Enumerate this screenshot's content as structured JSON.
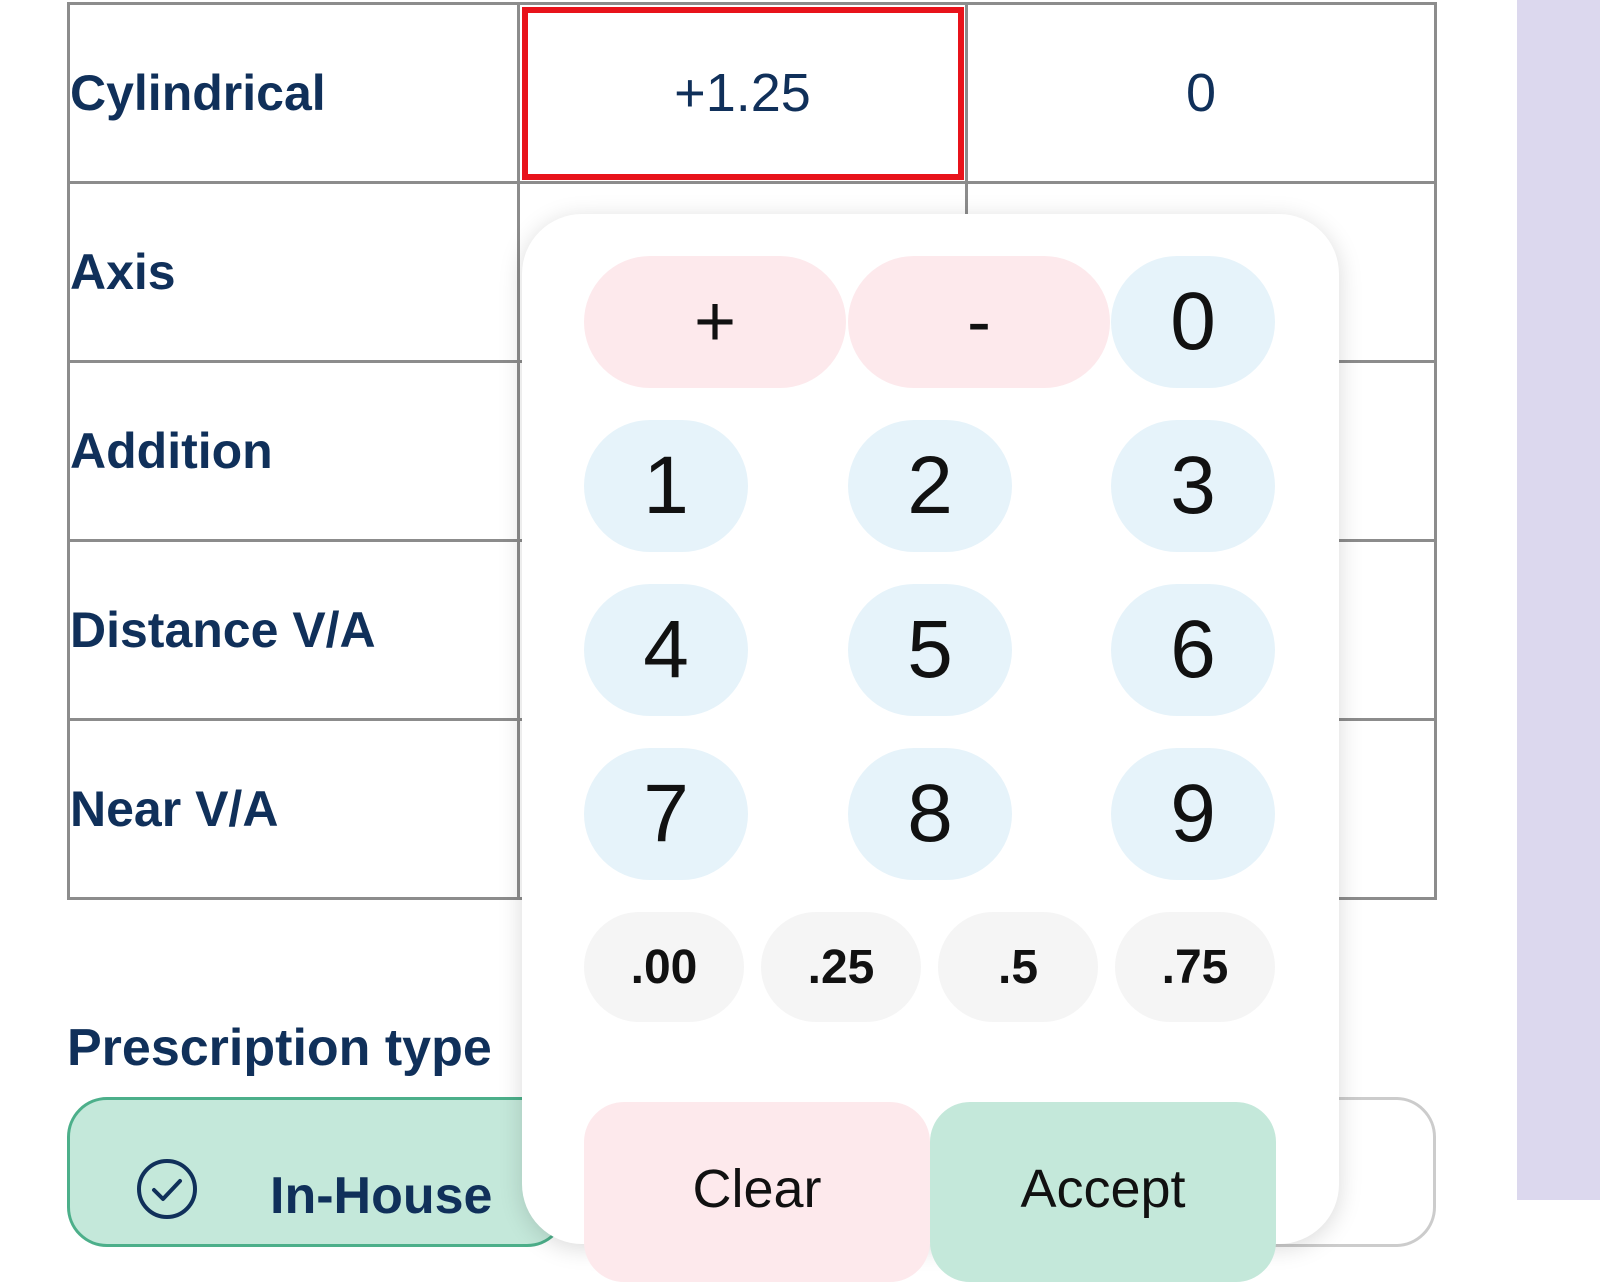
{
  "table": {
    "rows": [
      {
        "label": "Cylindrical",
        "right_value": "+1.25",
        "left_value": "0"
      },
      {
        "label": "Axis",
        "right_value": "",
        "left_value": ""
      },
      {
        "label": "Addition",
        "right_value": "",
        "left_value": ""
      },
      {
        "label": "Distance V/A",
        "right_value": "",
        "left_value": ""
      },
      {
        "label": "Near V/A",
        "right_value": "",
        "left_value": ""
      }
    ],
    "selected_cell": "Cylindrical right value"
  },
  "prescription_type": {
    "heading": "Prescription type",
    "options": [
      {
        "label": "In-House",
        "selected": true,
        "icon": "check-circle-icon"
      }
    ]
  },
  "keypad": {
    "sign_keys": [
      "+",
      "-"
    ],
    "digit_keys": [
      "0",
      "1",
      "2",
      "3",
      "4",
      "5",
      "6",
      "7",
      "8",
      "9"
    ],
    "fraction_keys": [
      ".00",
      ".25",
      ".5",
      ".75"
    ],
    "clear_label": "Clear",
    "accept_label": "Accept"
  },
  "colors": {
    "heading_text": "#10305a",
    "selected_outline": "#e8131b",
    "sign_key_bg": "#fde9ec",
    "digit_key_bg": "#e6f3fa",
    "accept_bg": "#c4e8da",
    "side_panel": "#dcd8ee"
  }
}
